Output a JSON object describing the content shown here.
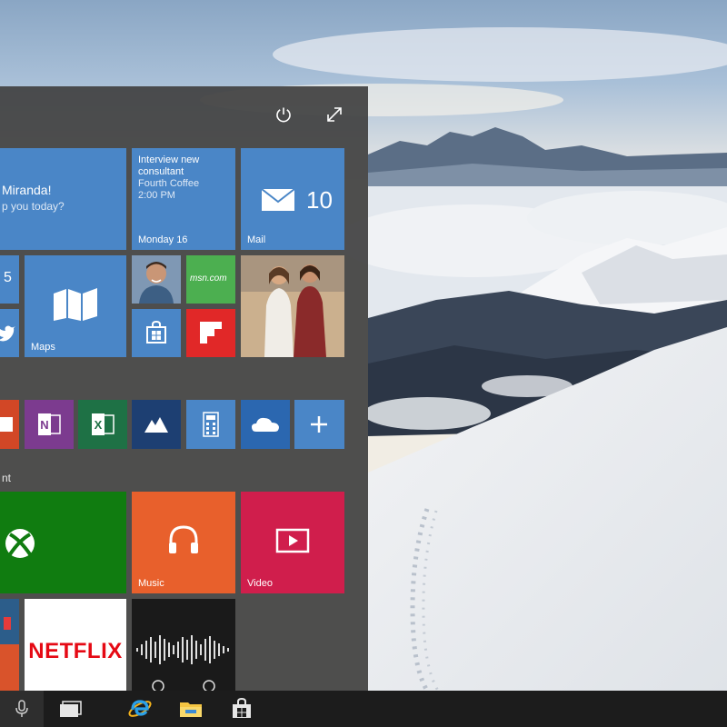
{
  "start_menu": {
    "power_icon": "power-icon",
    "expand_icon": "expand-icon",
    "tiles": {
      "people": {
        "line1": "Miranda!",
        "line2": "p you today?"
      },
      "calendar": {
        "line1": "Interview new",
        "line2": "consultant",
        "line3": "Fourth Coffee",
        "line4": "2:00 PM",
        "date": "Monday 16"
      },
      "mail": {
        "label": "Mail",
        "count": "10"
      },
      "small_left_top": "5",
      "maps": {
        "label": "Maps"
      },
      "photos_icon": "photo-tile",
      "store_icon": "store-icon",
      "flipboard_icon": "flipboard-icon",
      "msn_text": "msn.com",
      "music": {
        "label": "Music"
      },
      "video": {
        "label": "Video"
      },
      "netflix": {
        "label": "NETFLIX"
      }
    },
    "group_header": "nt"
  },
  "taskbar": {
    "icons": [
      "microphone-icon",
      "task-view-icon",
      "internet-explorer-icon",
      "file-explorer-icon",
      "store-icon"
    ]
  },
  "colors": {
    "tile_blue": "#4a86c7",
    "tile_dark_blue": "#2b67b0",
    "xbox_green": "#107c10",
    "music_orange": "#e8602c",
    "video_red": "#d01e4c",
    "onenote_purple": "#7c3b8f",
    "excel_green": "#1e7145",
    "netflix_red": "#e50914",
    "flipboard_red": "#e12828",
    "taskbar": "#1c1c1c"
  }
}
